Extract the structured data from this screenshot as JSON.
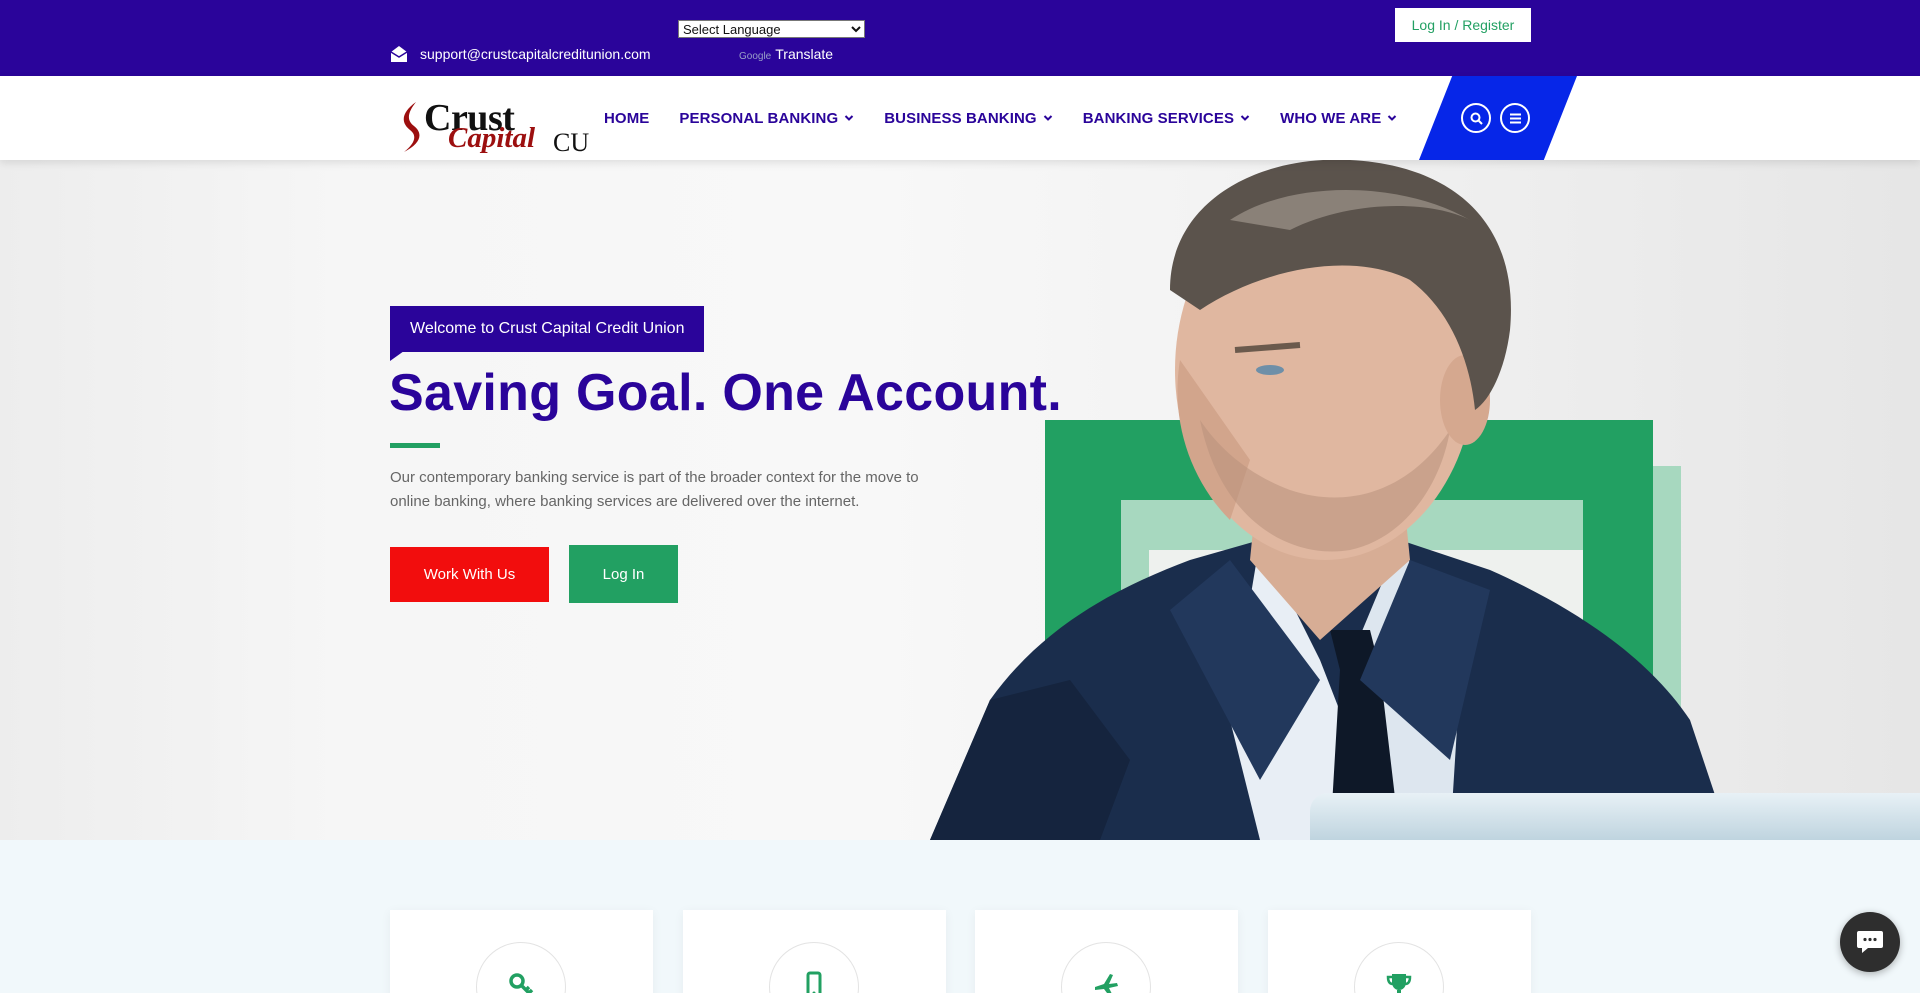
{
  "topbar": {
    "language_select": "Select Language",
    "translate_brand": "Google",
    "translate_label": "Translate",
    "email": "support@crustcapitalcreditunion.com",
    "login_register": "Log In / Register"
  },
  "logo": {
    "word1": "Crust",
    "word2": "Capital",
    "word3": "CU"
  },
  "nav": {
    "items": [
      {
        "label": "HOME",
        "dropdown": false
      },
      {
        "label": "PERSONAL BANKING",
        "dropdown": true
      },
      {
        "label": "BUSINESS BANKING",
        "dropdown": true
      },
      {
        "label": "BANKING SERVICES",
        "dropdown": true
      },
      {
        "label": "WHO WE ARE",
        "dropdown": true
      }
    ],
    "tools": [
      "search-icon",
      "menu-icon"
    ]
  },
  "hero": {
    "welcome": "Welcome to Crust Capital Credit Union",
    "headline": "Saving Goal. One Account.",
    "description": "Our contemporary banking service is part of the broader context for the move to online banking, where banking services are delivered over the internet.",
    "btn_work": "Work With Us",
    "btn_login": "Log In"
  },
  "services": {
    "icons": [
      "key-icon",
      "mobile-icon",
      "plane-icon",
      "trophy-icon"
    ]
  },
  "colors": {
    "primary": "#2a049a",
    "accent_blue": "#0626e8",
    "green": "#22a062",
    "red": "#f20d0d",
    "logo_red": "#9c0f0f"
  }
}
